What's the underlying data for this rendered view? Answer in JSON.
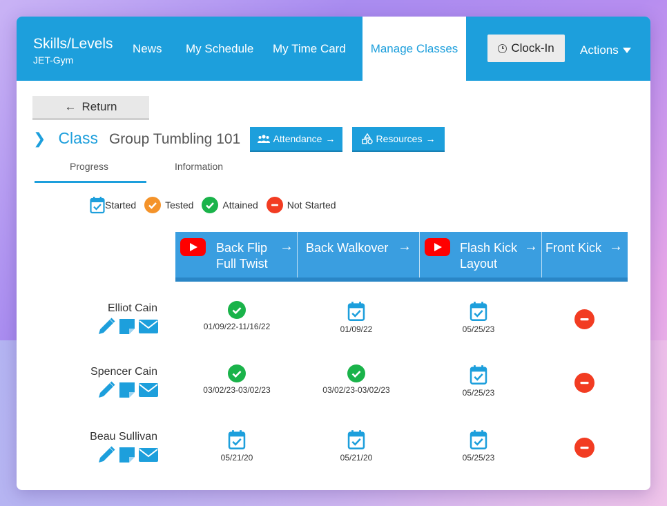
{
  "nav": {
    "brand_title": "Skills/Levels",
    "brand_sub": "JET-Gym",
    "links": [
      "News",
      "My Schedule",
      "My Time Card"
    ],
    "active": "Manage Classes",
    "clockin": "Clock-In",
    "actions": "Actions"
  },
  "page": {
    "return_label": "Return",
    "class_word": "Class",
    "class_name": "Group Tumbling 101",
    "attendance_label": "Attendance",
    "resources_label": "Resources",
    "tabs": [
      "Progress",
      "Information"
    ]
  },
  "legend": {
    "started": "Started",
    "tested": "Tested",
    "attained": "Attained",
    "not_started": "Not Started"
  },
  "skills": [
    {
      "line1": "Back Flip",
      "line2": "Full Twist",
      "video": true
    },
    {
      "line1": "Back Walkover",
      "line2": "",
      "video": false
    },
    {
      "line1": "Flash Kick",
      "line2": "Layout",
      "video": true
    },
    {
      "line1": "Front Kick",
      "line2": "",
      "video": false
    }
  ],
  "students": [
    {
      "name": "Elliot Cain",
      "cells": [
        {
          "status": "attained",
          "date": "01/09/22-11/16/22"
        },
        {
          "status": "started",
          "date": "01/09/22"
        },
        {
          "status": "started",
          "date": "05/25/23"
        },
        {
          "status": "not_started",
          "date": ""
        }
      ]
    },
    {
      "name": "Spencer Cain",
      "cells": [
        {
          "status": "attained",
          "date": "03/02/23-03/02/23"
        },
        {
          "status": "attained",
          "date": "03/02/23-03/02/23"
        },
        {
          "status": "started",
          "date": "05/25/23"
        },
        {
          "status": "not_started",
          "date": ""
        }
      ]
    },
    {
      "name": "Beau Sullivan",
      "cells": [
        {
          "status": "started",
          "date": "05/21/20"
        },
        {
          "status": "started",
          "date": "05/21/20"
        },
        {
          "status": "started",
          "date": "05/25/23"
        },
        {
          "status": "not_started",
          "date": ""
        }
      ]
    }
  ],
  "colors": {
    "primary": "#1d9fdc",
    "attained": "#1ab34a",
    "tested": "#f4932a",
    "not_started": "#f23c22"
  }
}
